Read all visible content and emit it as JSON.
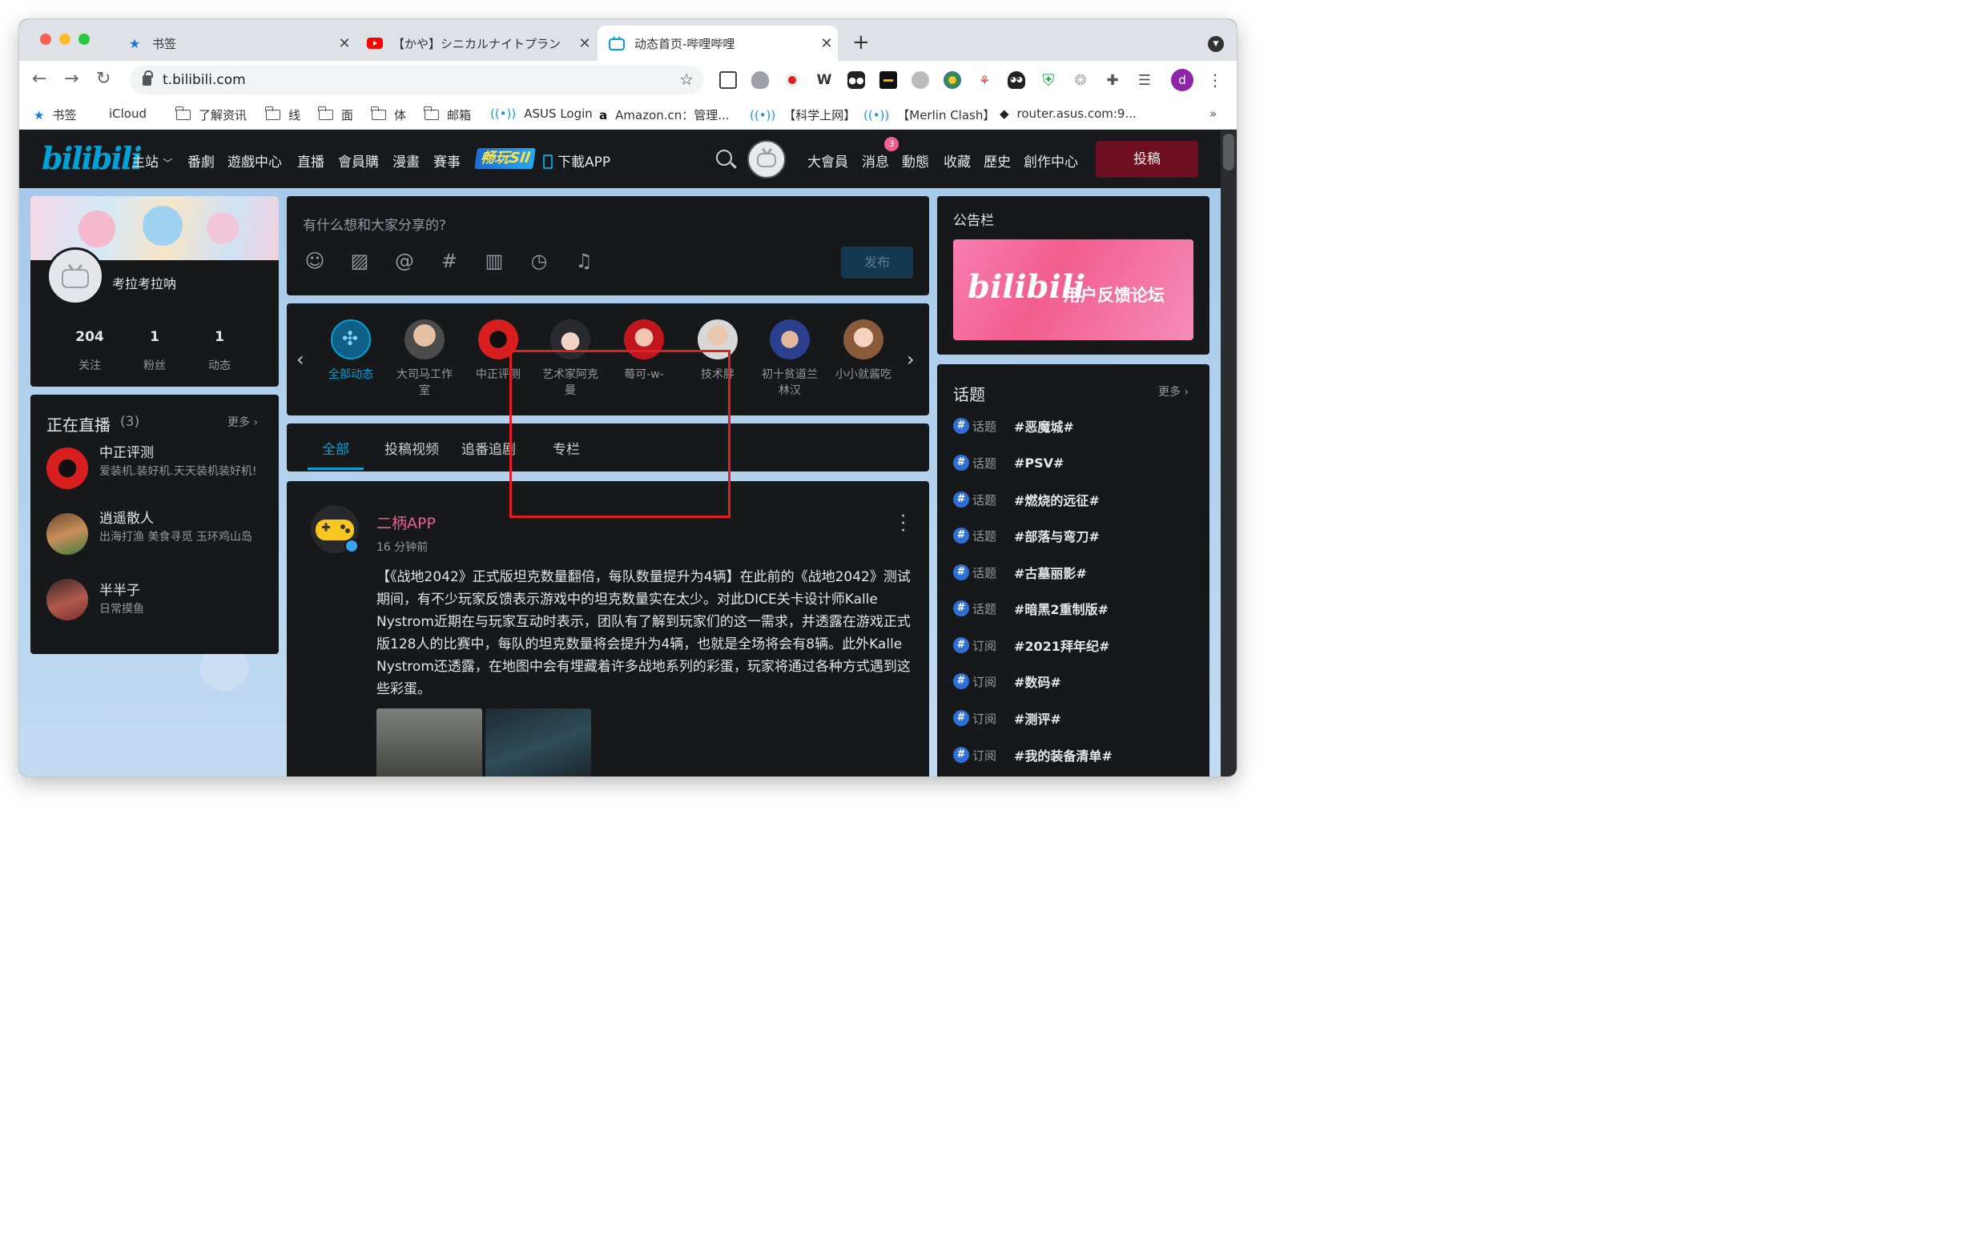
{
  "browser": {
    "tabs": [
      {
        "title": "书签",
        "icon": "star-icon",
        "active": false
      },
      {
        "title": "【かや】シニカルナイトプラン",
        "icon": "youtube-icon",
        "active": false
      },
      {
        "title": "动态首页-哔哩哔哩",
        "icon": "bilibili-tv-icon",
        "active": true
      }
    ],
    "url": "t.bilibili.com",
    "bookmarks": [
      {
        "label": "书签",
        "icon": "star-icon"
      },
      {
        "label": "iCloud",
        "icon": "apple-icon"
      },
      {
        "label": "了解资讯",
        "icon": "folder-icon"
      },
      {
        "label": "线",
        "icon": "folder-icon"
      },
      {
        "label": "面",
        "icon": "folder-icon"
      },
      {
        "label": "体",
        "icon": "folder-icon"
      },
      {
        "label": "邮箱",
        "icon": "folder-icon"
      },
      {
        "label": "ASUS Login",
        "icon": "signal-icon"
      },
      {
        "label": "Amazon.cn：管理...",
        "icon": "amazon-icon"
      },
      {
        "label": "【科学上网】",
        "icon": "signal-icon"
      },
      {
        "label": "【Merlin Clash】",
        "icon": "signal-icon"
      },
      {
        "label": "router.asus.com:9...",
        "icon": "cat-icon"
      }
    ],
    "bookmarks_overflow": "»",
    "profile_initial": "d"
  },
  "header": {
    "logo": "bilibili",
    "nav": [
      "主站",
      "番劇",
      "遊戲中心",
      "直播",
      "會員購",
      "漫畫",
      "賽事"
    ],
    "game_badge": "畅玩Sll",
    "download_app": "下載APP",
    "right_nav": [
      "大會員",
      "消息",
      "動態",
      "收藏",
      "歷史",
      "創作中心"
    ],
    "message_count": "3",
    "post_button": "投稿"
  },
  "profile": {
    "username": "考拉考拉呐",
    "stats": [
      {
        "value": "204",
        "label": "关注"
      },
      {
        "value": "1",
        "label": "粉丝"
      },
      {
        "value": "1",
        "label": "动态"
      }
    ]
  },
  "live": {
    "title": "正在直播",
    "count": "(3)",
    "more": "更多",
    "items": [
      {
        "name": "中正评测",
        "desc": "爱装机.装好机.天天装机装好机!"
      },
      {
        "name": "逍遥散人",
        "desc": "出海打渔 美食寻觅 玉环鸡山岛"
      },
      {
        "name": "半半子",
        "desc": "日常摸鱼"
      }
    ]
  },
  "composer": {
    "placeholder": "有什么想和大家分享的?",
    "icons": [
      "emoji-icon",
      "image-icon",
      "mention-icon",
      "topic-hash-icon",
      "vote-icon",
      "schedule-icon",
      "live-reserve-icon"
    ],
    "publish": "发布"
  },
  "ups": [
    {
      "name": "全部动态",
      "active": true
    },
    {
      "name": "大司马工作室",
      "active": false
    },
    {
      "name": "中正评测",
      "active": false
    },
    {
      "name": "艺术家阿克曼",
      "active": false
    },
    {
      "name": "莓可-w-",
      "active": false
    },
    {
      "name": "技术胖",
      "active": false
    },
    {
      "name": "初十贫道兰林汉",
      "active": false
    },
    {
      "name": "小小就酱吃",
      "active": false
    }
  ],
  "feed_tabs": [
    "全部",
    "投稿视频",
    "追番追剧",
    "专栏"
  ],
  "feed": {
    "author": "二柄APP",
    "time": "16 分钟前",
    "text": "【《战地2042》正式版坦克数量翻倍，每队数量提升为4辆】在此前的《战地2042》测试期间，有不少玩家反馈表示游戏中的坦克数量实在太少。对此DICE关卡设计师Kalle Nystrom近期在与玩家互动时表示，团队有了解到玩家们的这一需求，并透露在游戏正式版128人的比赛中，每队的坦克数量将会提升为4辆，也就是全场将会有8辆。此外Kalle Nystrom还透露，在地图中会有埋藏着许多战地系列的彩蛋，玩家将通过各种方式遇到这些彩蛋。"
  },
  "notice": {
    "title": "公告栏",
    "banner_logo": "bilibili",
    "banner_text": "用户反馈论坛"
  },
  "topics": {
    "title": "话题",
    "more": "更多",
    "items": [
      {
        "kind": "话题",
        "name": "#恶魔城#"
      },
      {
        "kind": "话题",
        "name": "#PSV#"
      },
      {
        "kind": "话题",
        "name": "#燃烧的远征#"
      },
      {
        "kind": "话题",
        "name": "#部落与弯刀#"
      },
      {
        "kind": "话题",
        "name": "#古墓丽影#"
      },
      {
        "kind": "话题",
        "name": "#暗黑2重制版#"
      },
      {
        "kind": "订阅",
        "name": "#2021拜年纪#"
      },
      {
        "kind": "订阅",
        "name": "#数码#"
      },
      {
        "kind": "订阅",
        "name": "#测评#"
      },
      {
        "kind": "订阅",
        "name": "#我的装备清单#"
      }
    ]
  },
  "colors": {
    "accent": "#00a1d6",
    "pink": "#f25d8e",
    "post_button": "#6e0f21",
    "highlight_box": "#e02020"
  }
}
